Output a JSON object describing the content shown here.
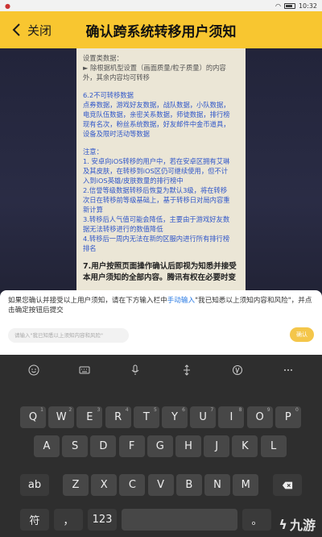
{
  "status": {
    "time": "10:32"
  },
  "header": {
    "back_label": "关闭",
    "title": "确认跨系统转移用户须知"
  },
  "content": {
    "lines": [
      {
        "t": "设置类数据：",
        "c": ""
      },
      {
        "t": "► 除根据机型设置（画面质量/粒子质量）的内容",
        "c": ""
      },
      {
        "t": "外，其余内容均可转移",
        "c": ""
      },
      {
        "t": "",
        "c": "gap"
      },
      {
        "t": "6.2不可转移数据",
        "c": "blue"
      },
      {
        "t": "点券数据，游戏好友数据，战队数据，小队数据，",
        "c": "blue"
      },
      {
        "t": "电竞队伍数据，亲密关系数据，师徒数据，排行榜",
        "c": "blue"
      },
      {
        "t": "现有名次，粉丝系统数据，好友邮件中金币道具，",
        "c": "blue"
      },
      {
        "t": "设备及限时活动等数据",
        "c": "blue"
      },
      {
        "t": "",
        "c": "gap"
      },
      {
        "t": "注意：",
        "c": "blue"
      },
      {
        "t": "1. 安卓向iOS转移的用户中，若在安卓区拥有艾琳",
        "c": "blue"
      },
      {
        "t": "及其皮肤，在转移到iOS区仍可继续使用，但不计",
        "c": "blue"
      },
      {
        "t": "入到iOS英雄/皮肤数量的排行榜中",
        "c": "blue"
      },
      {
        "t": "2.信誉等级数据转移后恢复为默认3级，将在转移",
        "c": "blue"
      },
      {
        "t": "次日在转移前等级基础上，基于转移日对局内容重",
        "c": "blue"
      },
      {
        "t": "新计算",
        "c": "blue"
      },
      {
        "t": "3.转移后人气值可能会降低，主要由于游戏好友数",
        "c": "blue"
      },
      {
        "t": "据无法转移进行的数值降低",
        "c": "blue"
      },
      {
        "t": "4.转移后一周内无法在新的区服内进行所有排行榜",
        "c": "blue"
      },
      {
        "t": "排名",
        "c": "blue"
      },
      {
        "t": "",
        "c": "gap"
      },
      {
        "t": "7.用户按照页面操作确认后即视为知悉并接受",
        "c": "bold"
      },
      {
        "t": "本用户须知的全部内容。腾讯有权在必要时变",
        "c": "bold"
      }
    ]
  },
  "dialog": {
    "msg_part1": "如果您确认并接受以上用户须知，请在下方输入栏中",
    "msg_highlight": "手动输入",
    "msg_part2": "\"我已知悉以上须知内容和风险\"，并点击确定按钮后提交",
    "input_placeholder": "请输入\"我已知悉以上须知内容和风险\"",
    "confirm_label": "确认"
  },
  "keyboard": {
    "row1": [
      {
        "k": "Q",
        "s": "1"
      },
      {
        "k": "W",
        "s": "2"
      },
      {
        "k": "E",
        "s": "3"
      },
      {
        "k": "R",
        "s": "4"
      },
      {
        "k": "T",
        "s": "5"
      },
      {
        "k": "Y",
        "s": "6"
      },
      {
        "k": "U",
        "s": "7"
      },
      {
        "k": "I",
        "s": "8"
      },
      {
        "k": "O",
        "s": "9"
      },
      {
        "k": "P",
        "s": "0"
      }
    ],
    "row2": [
      "A",
      "S",
      "D",
      "F",
      "G",
      "H",
      "J",
      "K",
      "L"
    ],
    "row3": [
      "Z",
      "X",
      "C",
      "V",
      "B",
      "N",
      "M"
    ],
    "shift_label": "ab",
    "sym_label": "符",
    "num_label": "123",
    "comma": "，",
    "period": "。",
    "watermark": "九游"
  }
}
